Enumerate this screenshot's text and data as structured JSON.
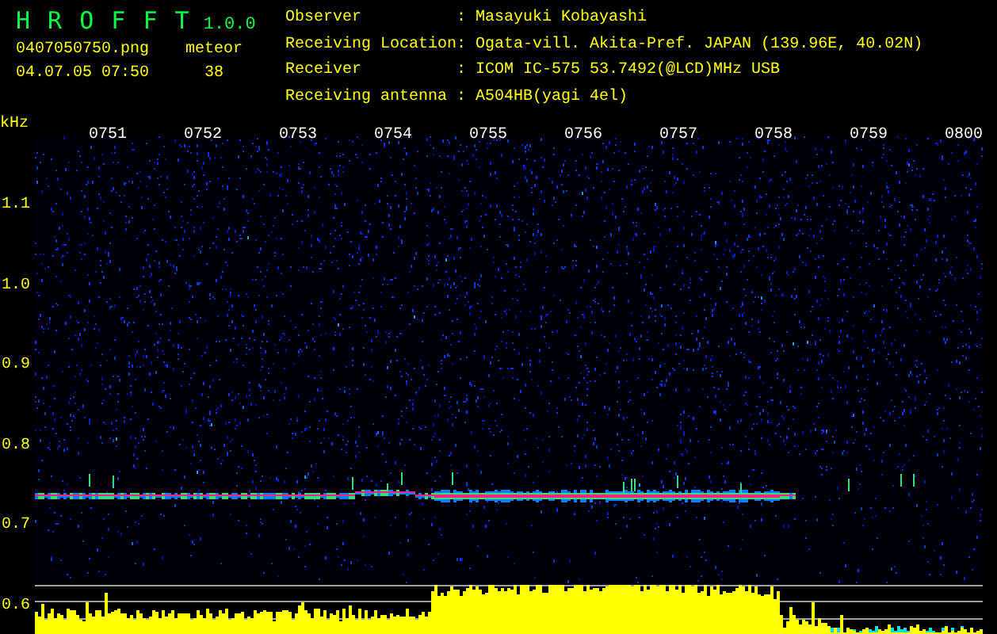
{
  "app": {
    "name": "H R O F F T",
    "version": "1.0.0"
  },
  "file": {
    "filename": "0407050750.png",
    "timestamp": "04.07.05 07:50",
    "count_label": "meteor",
    "count": "38"
  },
  "station_info": [
    {
      "label": "Observer",
      "separator": ":",
      "value": "Masayuki Kobayashi"
    },
    {
      "label": "Receiving Location",
      "separator": ":",
      "value": "Ogata-vill. Akita-Pref. JAPAN (139.96E, 40.02N)"
    },
    {
      "label": "Receiver",
      "separator": ":",
      "value": "ICOM IC-575 53.7492(@LCD)MHz USB"
    },
    {
      "label": "Receiving antenna",
      "separator": ":",
      "value": "A504HB(yagi 4el)"
    }
  ],
  "spectrogram": {
    "unit": "kHz",
    "time_labels": [
      "0751",
      "0752",
      "0753",
      "0754",
      "0755",
      "0756",
      "0757",
      "0758",
      "0759",
      "0800"
    ],
    "frequency_labels": [
      "1.1",
      "1.0",
      "0.9",
      "0.8",
      "0.7",
      "0.6"
    ]
  }
}
